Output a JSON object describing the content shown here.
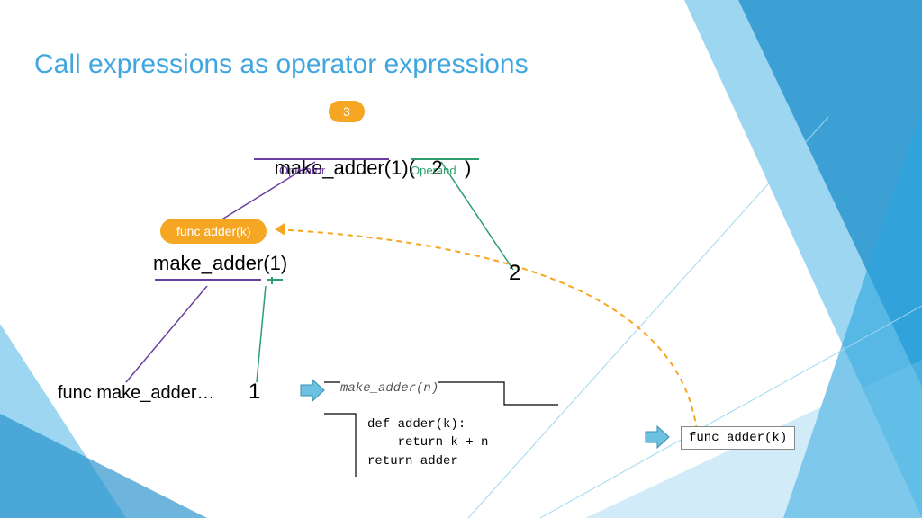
{
  "title": "Call expressions as operator expressions",
  "badge_result": "3",
  "main_expr_left": "make_adder(1)(",
  "main_expr_mid": "2",
  "main_expr_right": ")",
  "label_operator": "Operator",
  "label_operand": "Operand",
  "capsule_adder": "func adder(k)",
  "sub_expr": "make_adder(1)",
  "leaf_func": "func make_adder…",
  "leaf_one": "1",
  "leaf_two": "2",
  "code_header": "make_adder(n)",
  "code_body": "def adder(k):\n    return k + n\nreturn adder",
  "func_result": "func adder(k)",
  "colors": {
    "title": "#3fa6e0",
    "operator": "#6b3fa0",
    "operand": "#2e9e6f",
    "capsule": "#f5a623",
    "dash": "#f5a623"
  }
}
